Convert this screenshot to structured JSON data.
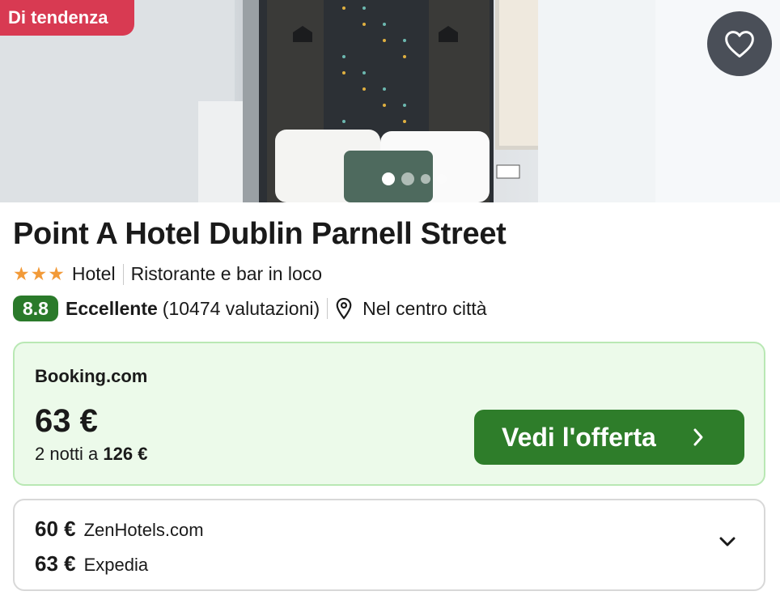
{
  "listing": {
    "badge": "Di tendenza",
    "title": "Point A Hotel Dublin Parnell Street",
    "stars": "★★★",
    "stars_count": 3,
    "type": "Hotel",
    "amenity": "Ristorante e bar in loco",
    "score": "8.8",
    "rating_label": "Eccellente",
    "reviews": "(10474 valutazioni)",
    "location": "Nel centro città",
    "image_count_dots": 4,
    "active_image_index": 0
  },
  "best_offer": {
    "provider": "Booking.com",
    "price": "63 €",
    "nights_text": "2 notti a",
    "total": "126 €",
    "cta": "Vedi l'offerta"
  },
  "other_offers": [
    {
      "price": "60 €",
      "provider": "ZenHotels.com"
    },
    {
      "price": "63 €",
      "provider": "Expedia"
    }
  ],
  "colors": {
    "badge": "#d83a52",
    "score_bg": "#2a7a2a",
    "cta_bg": "#2e7d2a",
    "offer_bg": "#ecfaea",
    "stars": "#f29a38"
  },
  "icons": [
    "heart-icon",
    "map-pin-icon",
    "chevron-right-icon",
    "chevron-down-icon",
    "star-icon"
  ]
}
